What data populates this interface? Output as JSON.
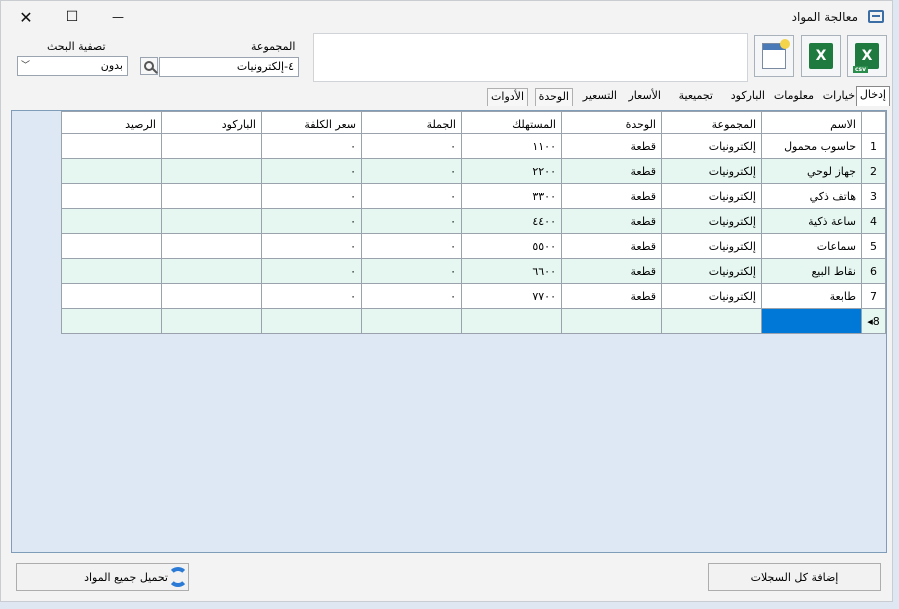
{
  "window": {
    "title": "معالجة المواد"
  },
  "titlebar": {
    "close_glyph": "✕",
    "maximize_glyph": "☐",
    "minimize_glyph": "—"
  },
  "toolbar": {
    "group_label": "المجموعة",
    "group_value": "٤-إلكترونيات",
    "filter_label": "تصفية البحث",
    "filter_value": "بدون",
    "icons": [
      "csv-excel-icon",
      "excel-icon",
      "new-document-icon"
    ],
    "excel_letter": "X",
    "csv_tag": "csv"
  },
  "tabs": [
    "إدخال",
    "خيارات",
    "معلومات",
    "الباركود",
    "تجميعية",
    "الأسعار",
    "التسعير",
    "الوحدة",
    "الأدوات"
  ],
  "grid": {
    "columns": [
      "الاسم",
      "المجموعة",
      "الوحدة",
      "المستهلك",
      "الجملة",
      "سعر الكلفة",
      "الباركود",
      "الرصيد"
    ],
    "rows": [
      {
        "rn": "1",
        "cells": [
          "حاسوب محمول",
          "إلكترونيات",
          "قطعة",
          "١١٠٠",
          "٠",
          "٠",
          "",
          ""
        ]
      },
      {
        "rn": "2",
        "cells": [
          "جهاز لوحي",
          "إلكترونيات",
          "قطعة",
          "٢٢٠٠",
          "٠",
          "٠",
          "",
          ""
        ]
      },
      {
        "rn": "3",
        "cells": [
          "هاتف ذكي",
          "إلكترونيات",
          "قطعة",
          "٣٣٠٠",
          "٠",
          "٠",
          "",
          ""
        ]
      },
      {
        "rn": "4",
        "cells": [
          "ساعة ذكية",
          "إلكترونيات",
          "قطعة",
          "٤٤٠٠",
          "٠",
          "٠",
          "",
          ""
        ]
      },
      {
        "rn": "5",
        "cells": [
          "سماعات",
          "إلكترونيات",
          "قطعة",
          "٥٥٠٠",
          "٠",
          "٠",
          "",
          ""
        ]
      },
      {
        "rn": "6",
        "cells": [
          "نقاط البيع",
          "إلكترونيات",
          "قطعة",
          "٦٦٠٠",
          "٠",
          "٠",
          "",
          ""
        ]
      },
      {
        "rn": "7",
        "cells": [
          "طابعة",
          "إلكترونيات",
          "قطعة",
          "٧٧٠٠",
          "٠",
          "٠",
          "",
          ""
        ]
      }
    ],
    "new_row_marker": "8◂"
  },
  "buttons": {
    "add_all_records": "إضافة كل السجلات",
    "load_all_items": "تحميل جميع المواد"
  }
}
